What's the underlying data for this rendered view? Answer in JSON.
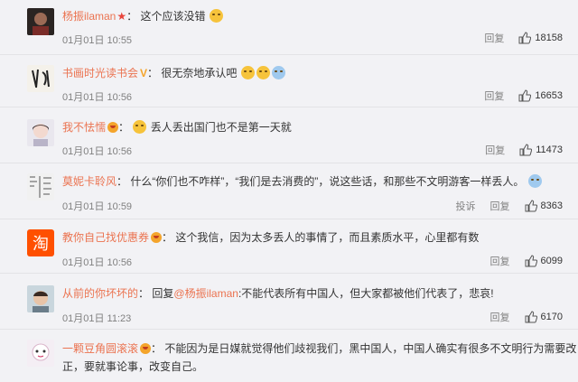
{
  "comments": [
    {
      "user": "杨振ilaman",
      "badge": "star",
      "text": "这个应该没错",
      "time": "01月01日 10:55",
      "reply": "回复",
      "likes": "18158"
    },
    {
      "user": "书画时光读书会",
      "badge": "v",
      "text": "很无奈地承认吧",
      "time": "01月01日 10:56",
      "reply": "回复",
      "likes": "16653"
    },
    {
      "user": "我不怯懦",
      "badge": "vip",
      "text": "丢人丢出国门也不是第一天就",
      "time": "01月01日 10:56",
      "reply": "回复",
      "likes": "11473"
    },
    {
      "user": "莫妮卡聆风",
      "badge": "",
      "text": "什么“你们也不咋样”，“我们是去消费的”，说这些话，和那些不文明游客一样丢人。",
      "time": "01月01日 10:59",
      "report": "投诉",
      "reply": "回复",
      "likes": "8363"
    },
    {
      "user": "教你自己找优惠券",
      "badge": "vip",
      "text": "这个我信，因为太多丢人的事情了，而且素质水平，心里都有数",
      "time": "01月01日 10:56",
      "reply": "回复",
      "likes": "6099"
    },
    {
      "user": "从前的你坏坏的",
      "badge": "",
      "reply_prefix": "回复",
      "mention": "@杨振ilaman",
      "text": ":不能代表所有中国人，但大家都被他们代表了，悲哀!",
      "time": "01月01日 11:23",
      "reply": "回复",
      "likes": "6170"
    },
    {
      "user": "一颗豆角圆滚滚",
      "badge": "vip",
      "text": "不能因为是日媒就觉得他们歧视我们，黑中国人，中国人确实有很多不文明行为需要改",
      "text2": "正，要就事论事，改变自己。"
    }
  ],
  "colors": {
    "username": "#eb7350",
    "background": "#f2f2f5",
    "meta": "#808080"
  }
}
